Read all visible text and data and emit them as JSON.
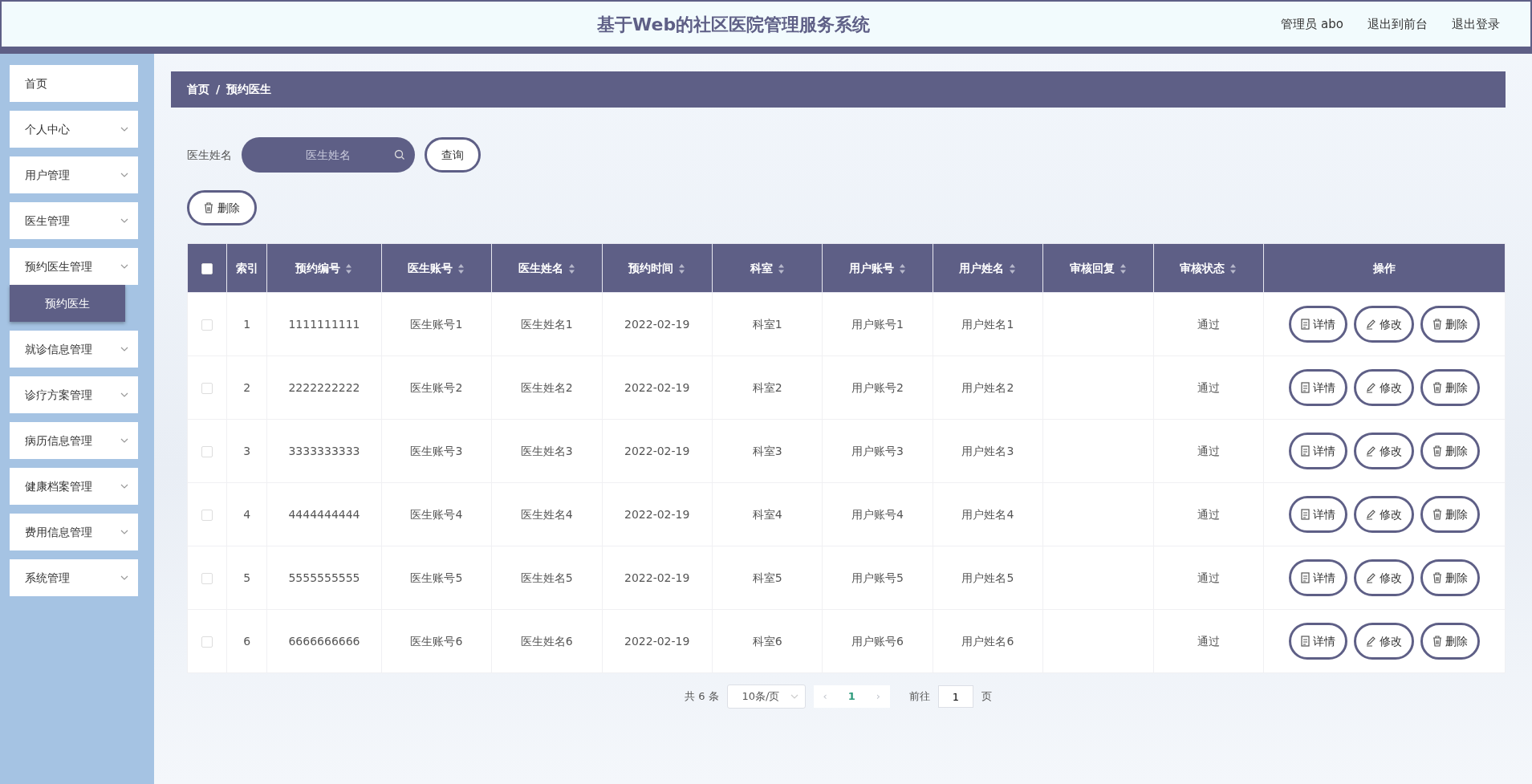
{
  "header": {
    "title": "基于Web的社区医院管理服务系统",
    "links": [
      "管理员 abo",
      "退出到前台",
      "退出登录"
    ]
  },
  "sidebar": {
    "items": [
      {
        "label": "首页",
        "expandable": false,
        "expanded": false
      },
      {
        "label": "个人中心",
        "expandable": true,
        "expanded": false
      },
      {
        "label": "用户管理",
        "expandable": true,
        "expanded": false
      },
      {
        "label": "医生管理",
        "expandable": true,
        "expanded": false
      },
      {
        "label": "预约医生管理",
        "expandable": true,
        "expanded": true,
        "children": [
          {
            "label": "预约医生",
            "selected": true
          }
        ]
      },
      {
        "label": "就诊信息管理",
        "expandable": true,
        "expanded": false
      },
      {
        "label": "诊疗方案管理",
        "expandable": true,
        "expanded": false
      },
      {
        "label": "病历信息管理",
        "expandable": true,
        "expanded": false
      },
      {
        "label": "健康档案管理",
        "expandable": true,
        "expanded": false
      },
      {
        "label": "费用信息管理",
        "expandable": true,
        "expanded": false
      },
      {
        "label": "系统管理",
        "expandable": true,
        "expanded": false
      }
    ]
  },
  "breadcrumb": {
    "items": [
      "首页",
      "预约医生"
    ],
    "separator": "/"
  },
  "search": {
    "label": "医生姓名",
    "placeholder": "医生姓名",
    "button": "查询"
  },
  "bulk_delete": "删除",
  "table": {
    "select_all_checked": false,
    "columns": [
      {
        "label": "索引",
        "sortable": false
      },
      {
        "label": "预约编号",
        "sortable": true
      },
      {
        "label": "医生账号",
        "sortable": true
      },
      {
        "label": "医生姓名",
        "sortable": true
      },
      {
        "label": "预约时间",
        "sortable": true
      },
      {
        "label": "科室",
        "sortable": true
      },
      {
        "label": "用户账号",
        "sortable": true
      },
      {
        "label": "用户姓名",
        "sortable": true
      },
      {
        "label": "审核回复",
        "sortable": true
      },
      {
        "label": "审核状态",
        "sortable": true
      },
      {
        "label": "操作",
        "sortable": false
      }
    ],
    "rows": [
      {
        "checked": false,
        "cells": [
          "1",
          "1111111111",
          "医生账号1",
          "医生姓名1",
          "2022-02-19",
          "科室1",
          "用户账号1",
          "用户姓名1",
          "",
          "通过"
        ],
        "actions": [
          "详情",
          "修改",
          "删除"
        ]
      },
      {
        "checked": false,
        "cells": [
          "2",
          "2222222222",
          "医生账号2",
          "医生姓名2",
          "2022-02-19",
          "科室2",
          "用户账号2",
          "用户姓名2",
          "",
          "通过"
        ],
        "actions": [
          "详情",
          "修改",
          "删除"
        ]
      },
      {
        "checked": false,
        "cells": [
          "3",
          "3333333333",
          "医生账号3",
          "医生姓名3",
          "2022-02-19",
          "科室3",
          "用户账号3",
          "用户姓名3",
          "",
          "通过"
        ],
        "actions": [
          "详情",
          "修改",
          "删除"
        ]
      },
      {
        "checked": false,
        "cells": [
          "4",
          "4444444444",
          "医生账号4",
          "医生姓名4",
          "2022-02-19",
          "科室4",
          "用户账号4",
          "用户姓名4",
          "",
          "通过"
        ],
        "actions": [
          "详情",
          "修改",
          "删除"
        ]
      },
      {
        "checked": false,
        "cells": [
          "5",
          "5555555555",
          "医生账号5",
          "医生姓名5",
          "2022-02-19",
          "科室5",
          "用户账号5",
          "用户姓名5",
          "",
          "通过"
        ],
        "actions": [
          "详情",
          "修改",
          "删除"
        ]
      },
      {
        "checked": false,
        "cells": [
          "6",
          "6666666666",
          "医生账号6",
          "医生姓名6",
          "2022-02-19",
          "科室6",
          "用户账号6",
          "用户姓名6",
          "",
          "通过"
        ],
        "actions": [
          "详情",
          "修改",
          "删除"
        ]
      }
    ]
  },
  "pagination": {
    "total": "共 6 条",
    "page_size": "10条/页",
    "prev": "‹",
    "pages": [
      {
        "label": "1",
        "selected": true
      }
    ],
    "next": "›",
    "goto_label": "前往",
    "goto_value": "1",
    "goto_suffix": "页"
  }
}
